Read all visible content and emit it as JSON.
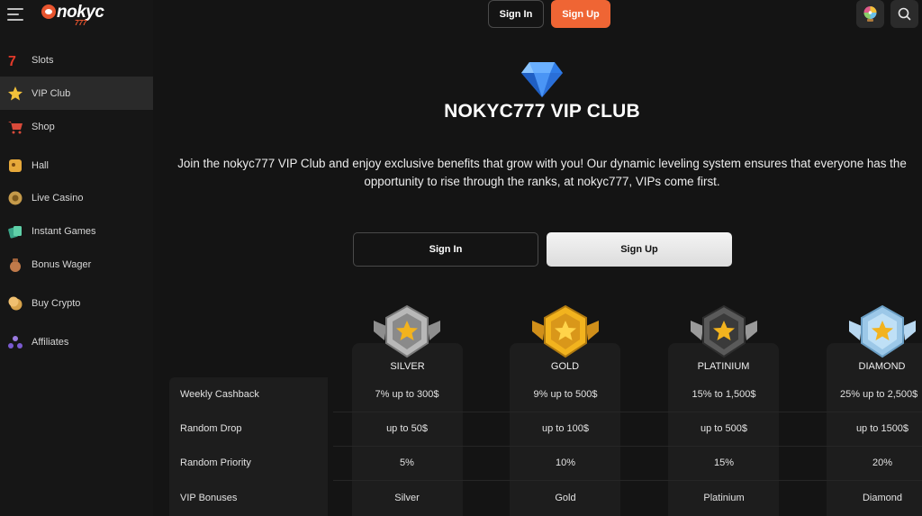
{
  "brand": {
    "name": "nokyc",
    "suffix": "777"
  },
  "sidebar": {
    "items": [
      {
        "label": "Slots",
        "icon": "slots-icon"
      },
      {
        "label": "VIP Club",
        "icon": "star-icon",
        "active": true
      },
      {
        "label": "Shop",
        "icon": "cart-icon"
      },
      {
        "label": "Hall",
        "icon": "hall-icon"
      },
      {
        "label": "Live Casino",
        "icon": "chip-icon"
      },
      {
        "label": "Instant Games",
        "icon": "cards-icon"
      },
      {
        "label": "Bonus Wager",
        "icon": "money-bag-icon"
      },
      {
        "label": "Buy Crypto",
        "icon": "coin-icon"
      },
      {
        "label": "Affiliates",
        "icon": "affiliates-icon"
      }
    ]
  },
  "header": {
    "signin_label": "Sign In",
    "signup_label": "Sign Up"
  },
  "hero": {
    "title": "NOKYC777 VIP CLUB",
    "text": "Join the nokyc777 VIP Club and enjoy exclusive benefits that grow with you! Our dynamic leveling system ensures that everyone has the opportunity to rise through the ranks, at nokyc777, VIPs come first.",
    "signin_label": "Sign In",
    "signup_label": "Sign Up"
  },
  "tiers": {
    "names": [
      "SILVER",
      "GOLD",
      "PLATINIUM",
      "DIAMOND"
    ],
    "rows": [
      {
        "label": "Weekly Cashback",
        "values": [
          "7% up to 300$",
          "9% up to 500$",
          "15% to 1,500$",
          "25% up to 2,500$"
        ]
      },
      {
        "label": "Random Drop",
        "values": [
          "up to 50$",
          "up to 100$",
          "up to 500$",
          "up to 1500$"
        ]
      },
      {
        "label": "Random Priority",
        "values": [
          "5%",
          "10%",
          "15%",
          "20%"
        ]
      },
      {
        "label": "VIP Bonuses",
        "values": [
          "Silver",
          "Gold",
          "Platinium",
          "Diamond"
        ]
      }
    ]
  },
  "colors": {
    "accent": "#ef6534",
    "background": "#141414",
    "sidebar": "#161616",
    "silver": "#a9a9a9",
    "gold": "#e6a626",
    "platinium": "#555555",
    "diamond": "#9cc8e8"
  }
}
